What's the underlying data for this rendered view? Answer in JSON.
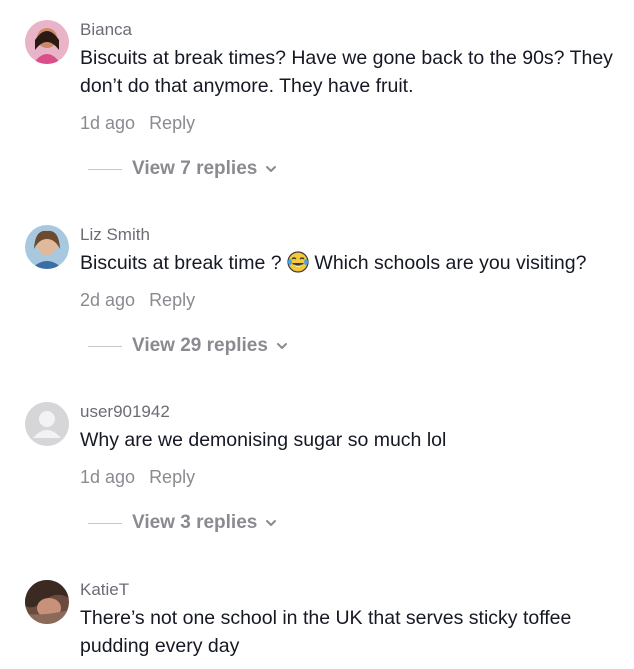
{
  "comments": [
    {
      "username": "Bianca",
      "text": "Biscuits at break times? Have we gone back to the 90s? They don’t do that anymore. They have fruit.",
      "time": "1d ago",
      "reply_label": "Reply",
      "view_replies": "View 7 replies"
    },
    {
      "username": "Liz Smith",
      "text_before": "Biscuits at break time ? ",
      "emoji": "tears-of-joy-emoji",
      "text_after": " Which schools are you visiting?",
      "time": "2d ago",
      "reply_label": "Reply",
      "view_replies": "View 29 replies"
    },
    {
      "username": "user901942",
      "text": "Why are we demonising sugar so much lol",
      "time": "1d ago",
      "reply_label": "Reply",
      "view_replies": "View 3 replies"
    },
    {
      "username": "KatieT",
      "text": "There’s not one school in the UK that serves sticky toffee pudding every day"
    }
  ],
  "icons": {
    "chevron": "chevron-down-icon",
    "default_avatar": "default-avatar-icon"
  },
  "colors": {
    "text": "#161823",
    "secondary": "#8a8b91",
    "username": "#6b6d74"
  }
}
